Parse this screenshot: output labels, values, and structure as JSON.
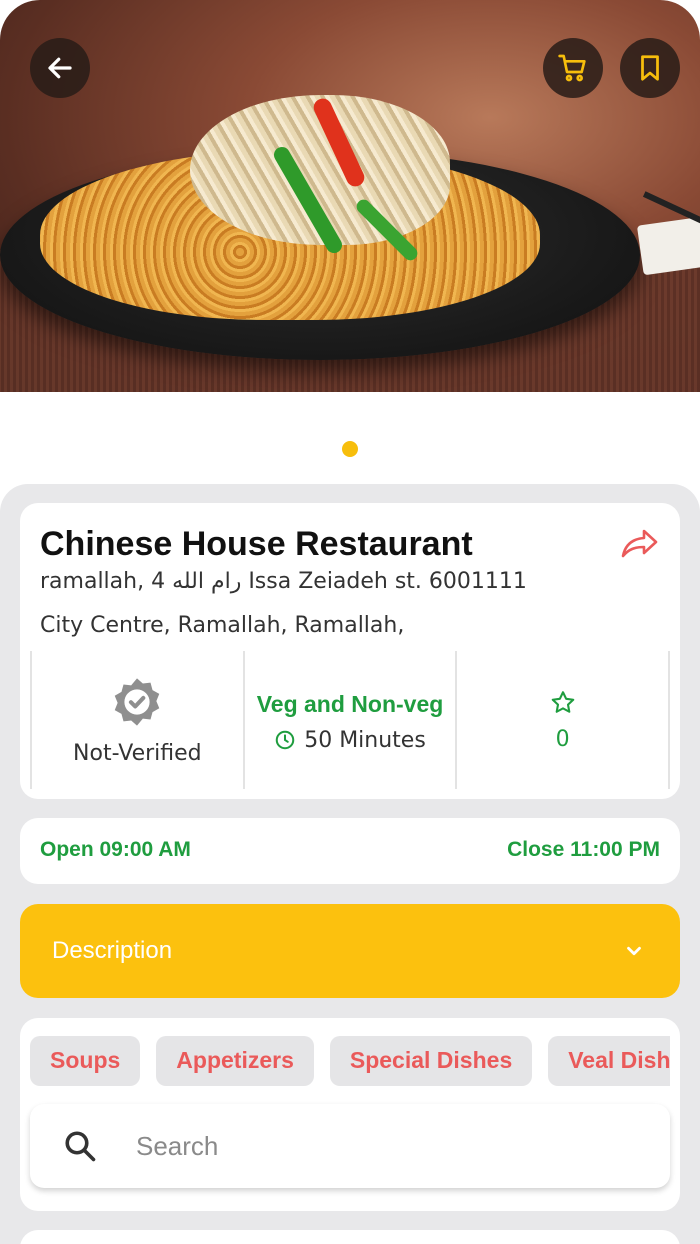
{
  "restaurant": {
    "name": "Chinese House Restaurant",
    "address_line1": "ramallah, 4 رام الله Issa Zeiadeh st. 6001111",
    "address_line2": "City Centre, Ramallah, Ramallah,"
  },
  "stats": {
    "verification": "Not-Verified",
    "food_type": "Veg and Non-veg",
    "delivery_time": "50 Minutes",
    "rating": "0"
  },
  "hours": {
    "open": "Open 09:00 AM",
    "close": "Close 11:00 PM"
  },
  "description": {
    "label": "Description"
  },
  "categories": [
    "Soups",
    "Appetizers",
    "Special Dishes",
    "Veal Dishes"
  ],
  "search": {
    "placeholder": "Search"
  },
  "colors": {
    "accent": "#fcc10e",
    "green": "#1f9d3f",
    "chip_text": "#ea5a5a",
    "panel_bg": "#e8e8ea"
  },
  "icons": {
    "back": "arrow-left-icon",
    "cart": "cart-icon",
    "bookmark": "bookmark-icon",
    "share": "share-icon",
    "verified": "verified-badge-icon",
    "clock": "clock-icon",
    "star": "star-icon",
    "chevron": "chevron-down-icon",
    "search": "search-icon"
  },
  "carousel": {
    "current": 1,
    "total": 1
  }
}
